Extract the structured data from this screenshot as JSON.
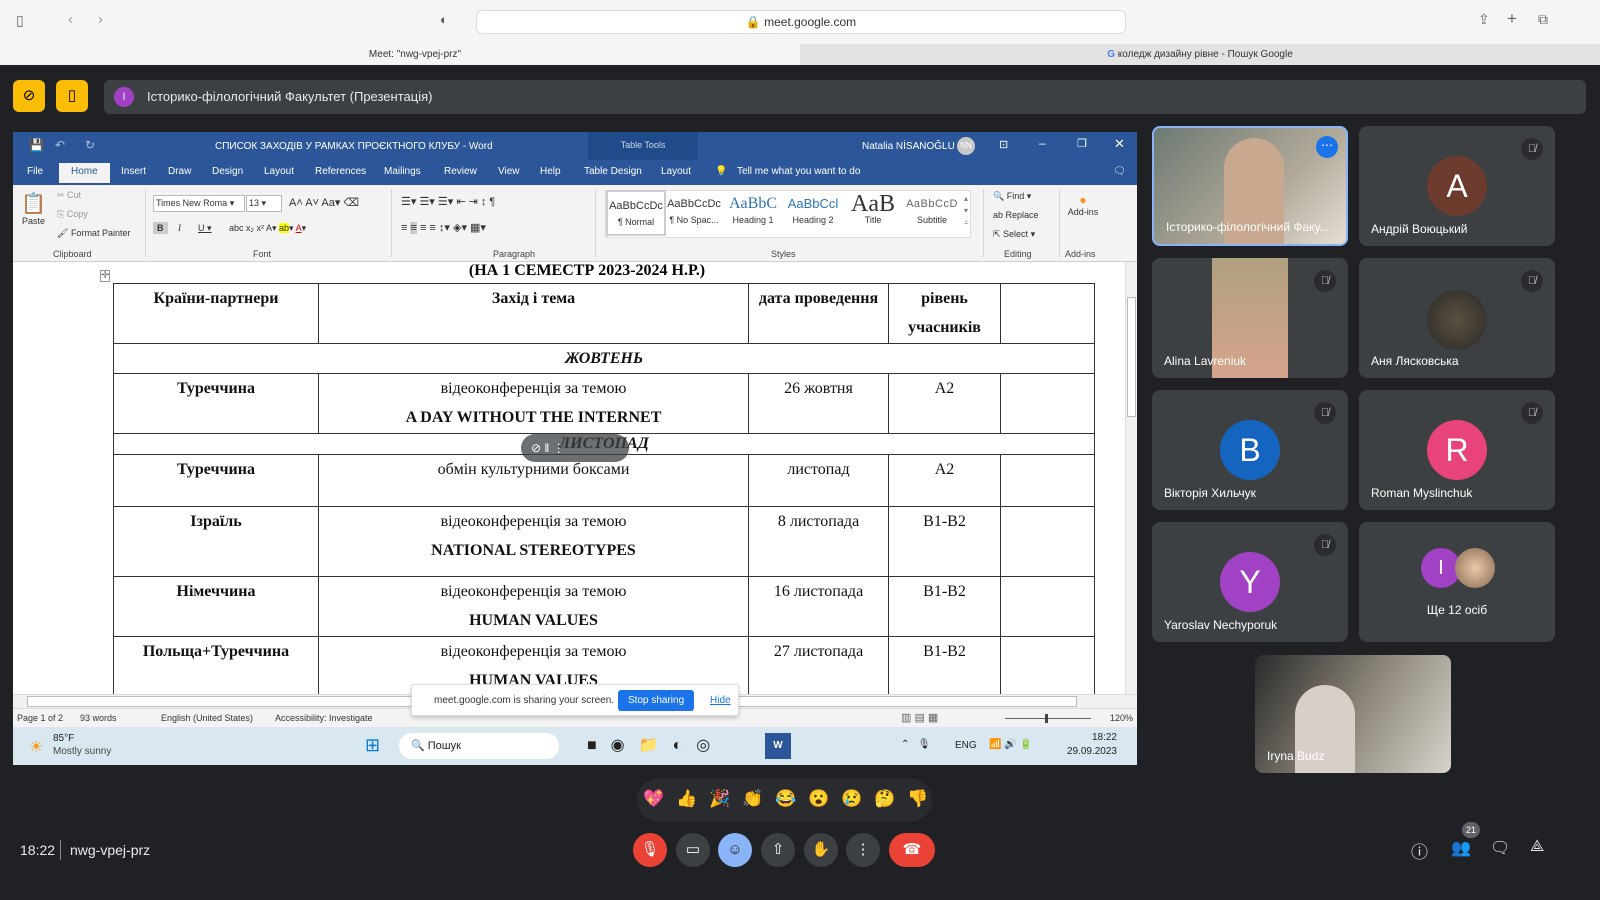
{
  "browser": {
    "url": "meet.google.com",
    "tabs": [
      "Meet: \"nwg-vpej-prz\"",
      "коледж дизайну рівне - Пошук Google"
    ]
  },
  "presentation": {
    "avatar_letter": "І",
    "title": "Історико-філологічний Факультет (Презентація)"
  },
  "word": {
    "title": "СПИСОК ЗАХОДІВ У РАМКАХ ПРОЄКТНОГО КЛУБУ  -  Word",
    "table_tools": "Table Tools",
    "user": "Natalia NİSANOĞLU",
    "user_initials": "NN",
    "tabs": [
      "File",
      "Home",
      "Insert",
      "Draw",
      "Design",
      "Layout",
      "References",
      "Mailings",
      "Review",
      "View",
      "Help",
      "Table Design",
      "Layout"
    ],
    "tell_me": "Tell me what you want to do",
    "clipboard": {
      "paste": "Paste",
      "cut": "Cut",
      "copy": "Copy",
      "format_painter": "Format Painter",
      "label": "Clipboard"
    },
    "font": {
      "name": "Times New Roma",
      "size": "13",
      "label": "Font"
    },
    "paragraph_label": "Paragraph",
    "styles": [
      {
        "sample": "AaBbCcDc",
        "name": "¶ Normal"
      },
      {
        "sample": "AaBbCcDc",
        "name": "¶ No Spac..."
      },
      {
        "sample": "AaBbC",
        "name": "Heading 1"
      },
      {
        "sample": "AaBbCcl",
        "name": "Heading 2"
      },
      {
        "sample": "AaB",
        "name": "Title"
      },
      {
        "sample": "AaBbCcD",
        "name": "Subtitle"
      }
    ],
    "styles_label": "Styles",
    "editing": {
      "find": "Find",
      "replace": "Replace",
      "select": "Select",
      "label": "Editing"
    },
    "addins": {
      "button": "Add-ins",
      "label": "Add-ins"
    },
    "doc": {
      "heading": "(НА 1 СЕМЕСТР 2023-2024 Н.Р.)",
      "headers": [
        "Країни-партнери",
        "Захід і тема",
        "дата проведення",
        "рівень учасників",
        ""
      ],
      "months": [
        "ЖОВТЕНЬ",
        "ЛИСТОПАД"
      ],
      "rows": [
        {
          "country": "Туреччина",
          "event": "відеоконференція за темою",
          "topic": "A DAY WITHOUT THE INTERNET",
          "date": "26 жовтня",
          "level": "A2"
        },
        {
          "country": "Туреччина",
          "event": "обмін культурними боксами",
          "topic": "",
          "date": "листопад",
          "level": "A2"
        },
        {
          "country": "Ізраїль",
          "event": "відеоконференція за темою",
          "topic": "NATIONAL STEREOTYPES",
          "date": "8 листопада",
          "level": "B1-B2"
        },
        {
          "country": "Німеччина",
          "event": "відеоконференція за темою",
          "topic": "HUMAN VALUES",
          "date": "16 листопада",
          "level": "B1-B2"
        },
        {
          "country": "Польща+Туреччина",
          "event": "відеоконференція за темою",
          "topic": "HUMAN VALUES",
          "date": "27 листопада",
          "level": "B1-B2"
        }
      ]
    },
    "status": {
      "page": "Page 1 of 2",
      "words": "93 words",
      "language": "English (United States)",
      "accessibility": "Accessibility: Investigate",
      "zoom": "120%"
    },
    "sharing": {
      "text": "meet.google.com is sharing your screen.",
      "stop": "Stop sharing",
      "hide": "Hide"
    }
  },
  "taskbar": {
    "temp": "85°F",
    "weather": "Mostly sunny",
    "search": "Пошук",
    "lang": "ENG",
    "time": "18:22",
    "date": "29.09.2023"
  },
  "participants": [
    {
      "name": "Історико-філологічний Факу...",
      "type": "video"
    },
    {
      "name": "Андрій Воюцький",
      "letter": "A",
      "color": "#6d3a2e"
    },
    {
      "name": "Alina Lavreniuk",
      "type": "video"
    },
    {
      "name": "Аня Лясковська",
      "type": "photo"
    },
    {
      "name": "Вікторія Хильчук",
      "letter": "B",
      "color": "#1565c0"
    },
    {
      "name": "Roman Myslinchuk",
      "letter": "R",
      "color": "#e8437a"
    },
    {
      "name": "Yaroslav Nechyporuk",
      "letter": "Y",
      "color": "#a142c4"
    },
    {
      "name": "Ще 12 осіб",
      "letter": "I",
      "color": "#a142c4"
    },
    {
      "name": "Iryna Budz",
      "type": "video"
    }
  ],
  "meeting": {
    "time": "18:22",
    "code": "nwg-vpej-prz",
    "participant_count": "21"
  },
  "reactions": [
    "💖",
    "👍",
    "🎉",
    "👏",
    "😂",
    "😮",
    "😢",
    "🤔",
    "👎"
  ]
}
